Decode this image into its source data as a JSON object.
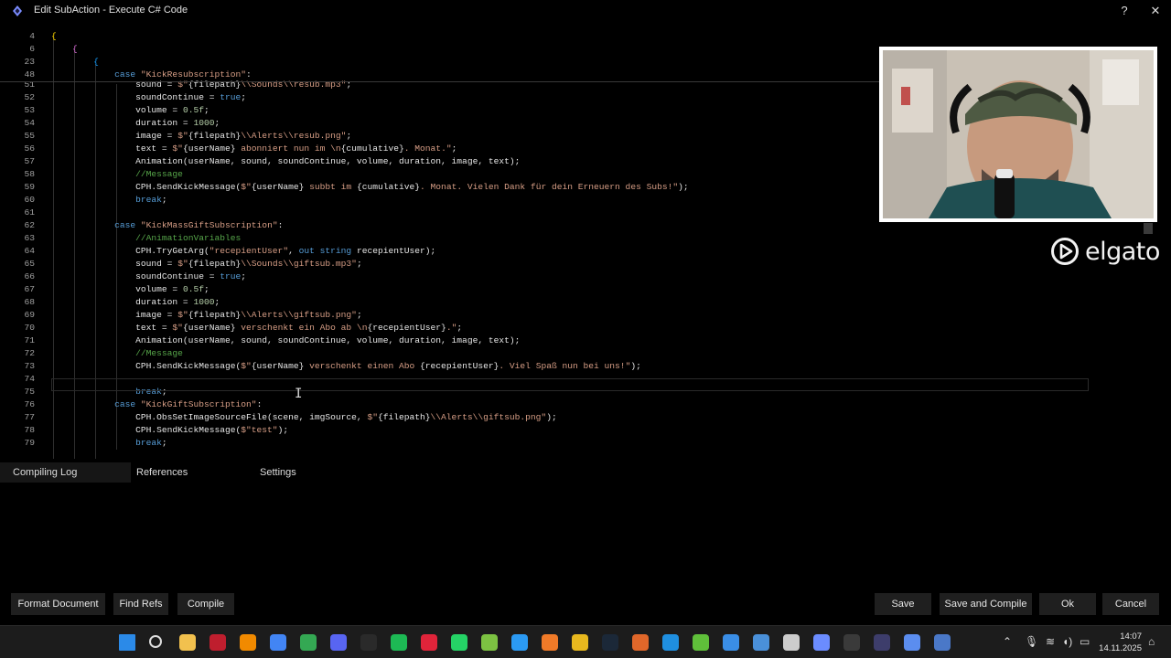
{
  "window": {
    "title": "Edit SubAction - Execute C# Code",
    "help_label": "?",
    "close_label": "✕"
  },
  "editor": {
    "lines": [
      {
        "n": "4",
        "html": "<span class='br'>{</span>"
      },
      {
        "n": "6",
        "html": "    <span class='br2'>{</span>"
      },
      {
        "n": "23",
        "html": "        <span class='br3'>{</span>"
      },
      {
        "n": "48",
        "html": "            <span class='kw'>case</span> <span class='str'>\"KickResubscription\"</span>:"
      },
      {
        "n": "51",
        "html": "                sound = <span class='str'>$\"</span>{filepath}<span class='str'>\\\\Sounds\\\\resub.mp3\"</span>;"
      },
      {
        "n": "52",
        "html": "                soundContinue = <span class='kw'>true</span>;"
      },
      {
        "n": "53",
        "html": "                volume = <span class='num'>0.5f</span>;"
      },
      {
        "n": "54",
        "html": "                duration = <span class='num'>1000</span>;"
      },
      {
        "n": "55",
        "html": "                image = <span class='str'>$\"</span>{filepath}<span class='str'>\\\\Alerts\\\\resub.png\"</span>;"
      },
      {
        "n": "56",
        "html": "                text = <span class='str'>$\"</span>{userName}<span class='str'> abonniert nun im \\n</span>{cumulative}<span class='str'>. Monat.\"</span>;"
      },
      {
        "n": "57",
        "html": "                Animation(userName, sound, soundContinue, volume, duration, image, text);"
      },
      {
        "n": "58",
        "html": "                <span class='cmt'>//Message</span>"
      },
      {
        "n": "59",
        "html": "                CPH.SendKickMessage(<span class='str'>$\"</span>{userName}<span class='str'> subbt im </span>{cumulative}<span class='str'>. Monat. Vielen Dank für dein Erneuern des Subs!\"</span>);"
      },
      {
        "n": "60",
        "html": "                <span class='kw'>break</span>;"
      },
      {
        "n": "61",
        "html": ""
      },
      {
        "n": "62",
        "html": "            <span class='kw'>case</span> <span class='str'>\"KickMassGiftSubscription\"</span>:"
      },
      {
        "n": "63",
        "html": "                <span class='cmt'>//AnimationVariables</span>"
      },
      {
        "n": "64",
        "html": "                CPH.TryGetArg(<span class='str'>\"recepientUser\"</span>, <span class='kw'>out</span> <span class='kw'>string</span> recepientUser);"
      },
      {
        "n": "65",
        "html": "                sound = <span class='str'>$\"</span>{filepath}<span class='str'>\\\\Sounds\\\\giftsub.mp3\"</span>;"
      },
      {
        "n": "66",
        "html": "                soundContinue = <span class='kw'>true</span>;"
      },
      {
        "n": "67",
        "html": "                volume = <span class='num'>0.5f</span>;"
      },
      {
        "n": "68",
        "html": "                duration = <span class='num'>1000</span>;"
      },
      {
        "n": "69",
        "html": "                image = <span class='str'>$\"</span>{filepath}<span class='str'>\\\\Alerts\\\\giftsub.png\"</span>;"
      },
      {
        "n": "70",
        "html": "                text = <span class='str'>$\"</span>{userName}<span class='str'> verschenkt ein Abo ab \\n</span>{recepientUser}<span class='str'>.\"</span>;"
      },
      {
        "n": "71",
        "html": "                Animation(userName, sound, soundContinue, volume, duration, image, text);"
      },
      {
        "n": "72",
        "html": "                <span class='cmt'>//Message</span>"
      },
      {
        "n": "73",
        "html": "                CPH.SendKickMessage(<span class='str'>$\"</span>{userName}<span class='str'> verschenkt einen Abo </span>{recepientUser}<span class='str'>. Viel Spaß nun bei uns!\"</span>);"
      },
      {
        "n": "74",
        "html": ""
      },
      {
        "n": "75",
        "html": "                <span class='kw'>break</span>;"
      },
      {
        "n": "76",
        "html": "            <span class='kw'>case</span> <span class='str'>\"KickGiftSubscription\"</span>:"
      },
      {
        "n": "77",
        "html": "                CPH.ObsSetImageSourceFile(scene, imgSource, <span class='str'>$\"</span>{filepath}<span class='str'>\\\\Alerts\\\\giftsub.png\"</span>);"
      },
      {
        "n": "78",
        "html": "                CPH.SendKickMessage(<span class='str'>$\"test\"</span>);"
      },
      {
        "n": "79",
        "html": "                <span class='kw'>break</span>;"
      }
    ]
  },
  "overlay": {
    "brand": "elgato"
  },
  "tabs": {
    "compiling_log": "Compiling Log",
    "references": "References",
    "settings": "Settings"
  },
  "buttons": {
    "format_document": "Format Document",
    "find_refs": "Find Refs",
    "compile": "Compile",
    "save": "Save",
    "save_and_compile": "Save and Compile",
    "ok": "Ok",
    "cancel": "Cancel"
  },
  "taskbar": {
    "icons": [
      {
        "name": "windows-start-icon",
        "color": "#2b8ae8"
      },
      {
        "name": "search-icon",
        "color": "#dddddd"
      },
      {
        "name": "file-explorer-icon",
        "color": "#f2c14e"
      },
      {
        "name": "filezilla-icon",
        "color": "#bf1e2e"
      },
      {
        "name": "vlc-icon",
        "color": "#f18a00"
      },
      {
        "name": "chrome-icon",
        "color": "#4285f4"
      },
      {
        "name": "chrome-profile-icon",
        "color": "#34a853"
      },
      {
        "name": "discord-icon",
        "color": "#5865f2"
      },
      {
        "name": "epic-games-icon",
        "color": "#2a2a2a"
      },
      {
        "name": "spotify-icon",
        "color": "#1db954"
      },
      {
        "name": "app-red-diamond-icon",
        "color": "#e0243a"
      },
      {
        "name": "whatsapp-icon",
        "color": "#25d366"
      },
      {
        "name": "notepad-plus-icon",
        "color": "#7cc242"
      },
      {
        "name": "vscode-icon",
        "color": "#2b9af3"
      },
      {
        "name": "affinity-icon",
        "color": "#f07a28"
      },
      {
        "name": "app-yellow-icon",
        "color": "#e8b81e"
      },
      {
        "name": "steam-icon",
        "color": "#1b2838"
      },
      {
        "name": "app-orange-icon",
        "color": "#e0672a"
      },
      {
        "name": "app-blue-square-icon",
        "color": "#1f8fe0"
      },
      {
        "name": "app-green-cube-icon",
        "color": "#5fbf3a"
      },
      {
        "name": "app-blue-drop-icon",
        "color": "#3a8ee6"
      },
      {
        "name": "app-network-icon",
        "color": "#4a90d9"
      },
      {
        "name": "obs-icon",
        "color": "#cccccc"
      },
      {
        "name": "streamerbot-icon",
        "color": "#6b8cff"
      },
      {
        "name": "app-davinci-icon",
        "color": "#3a3a3a"
      },
      {
        "name": "app-dark-circle-icon",
        "color": "#3d3d6b"
      },
      {
        "name": "app-notes-icon",
        "color": "#5b8def"
      },
      {
        "name": "app-audio-icon",
        "color": "#4a78c8"
      }
    ],
    "clock_time": "14:07",
    "clock_date": "14.11.2025"
  }
}
